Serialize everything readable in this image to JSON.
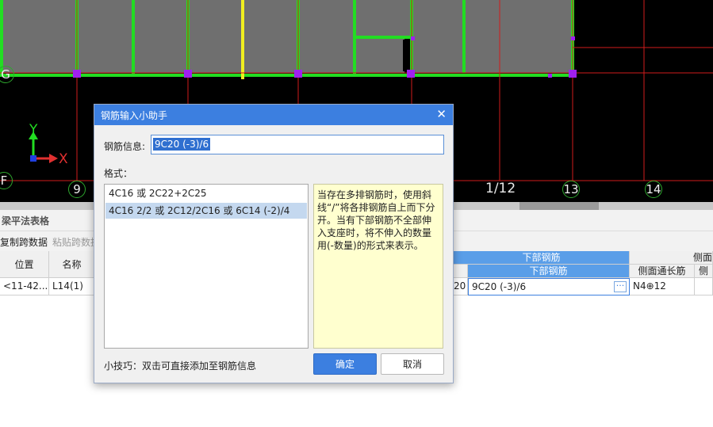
{
  "cad": {
    "colors": {
      "background": "#000000",
      "beam": "#22dd22",
      "fill": "#6f6f6f",
      "grid_line": "#d11b1b",
      "node": "#a020f0",
      "highlight": "#f0ee20"
    },
    "row_axes": [
      "G",
      "F"
    ],
    "col_axes": [
      "9",
      "1/12",
      "13",
      "14"
    ],
    "coord_icon": {
      "y": "Y",
      "x": "X"
    }
  },
  "panel": {
    "title": "梁平法表格",
    "toolbar": {
      "copy_span": "复制跨数据",
      "paste_span": "粘贴跨数据"
    },
    "table": {
      "headers": {
        "position": "位置",
        "name": "名称",
        "bottom_rebar_group": "下部钢筋",
        "bottom_rebar": "下部钢筋",
        "side_group": "侧面",
        "side_through": "侧面通长筋",
        "side_extra": "侧"
      },
      "row": {
        "position": "<11-42...",
        "name": "L14(1)",
        "partial": "20",
        "bottom_rebar": "9C20 (-3)/6",
        "side_through": "N4⊕12"
      }
    }
  },
  "dialog": {
    "title": "钢筋输入小助手",
    "info_label": "钢筋信息:",
    "info_value": "9C20 (-3)/6",
    "format_label": "格式：",
    "formats": [
      "4C16 或 2C22+2C25",
      "4C16 2/2 或 2C12/2C16 或 6C14 (-2)/4"
    ],
    "tip": "当存在多排钢筋时，使用斜线“/”将各排钢筋自上而下分开。当有下部钢筋不全部伸入支座时，将不伸入的数量用(-数量)的形式来表示。",
    "hint": "小技巧：双击可直接添加至钢筋信息",
    "ok": "确定",
    "cancel": "取消"
  }
}
